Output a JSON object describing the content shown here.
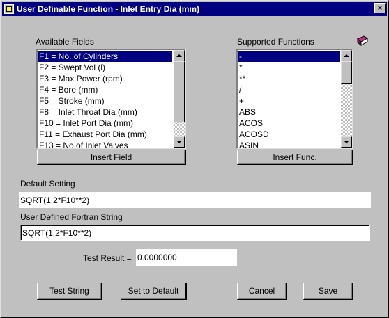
{
  "window": {
    "title": "User Definable Function - Inlet Entry Dia (mm)",
    "close_glyph": "×"
  },
  "available_fields": {
    "label": "Available Fields",
    "items": [
      "F1 = No. of Cylinders",
      "F2 = Swept Vol (l)",
      "F3 = Max Power (rpm)",
      "F4 = Bore (mm)",
      "F5 = Stroke (mm)",
      "F8 = Inlet Throat Dia (mm)",
      "F10 = Inlet Port Dia (mm)",
      "F11 = Exhaust Port Dia (mm)",
      "F13 = No of Inlet Valves"
    ],
    "selected_index": 0,
    "insert_button": "Insert Field"
  },
  "supported_functions": {
    "label": "Supported Functions",
    "items": [
      "-",
      "*",
      "**",
      "/",
      "+",
      "ABS",
      "ACOS",
      "ACOSD",
      "ASIN"
    ],
    "selected_index": 0,
    "insert_button": "Insert Func."
  },
  "default_setting": {
    "label": "Default Setting",
    "value": "SQRT(1.2*F10**2)"
  },
  "user_defined": {
    "label": "User Defined Fortran String",
    "value": "SQRT(1.2*F10**2)"
  },
  "test_result": {
    "label": "Test Result =",
    "value": "0.0000000"
  },
  "buttons": {
    "test_string": "Test String",
    "set_default": "Set to Default",
    "cancel": "Cancel",
    "save": "Save"
  },
  "icons": {
    "help": "book-icon",
    "title": "app-icon",
    "help_color": "#a0206a"
  }
}
